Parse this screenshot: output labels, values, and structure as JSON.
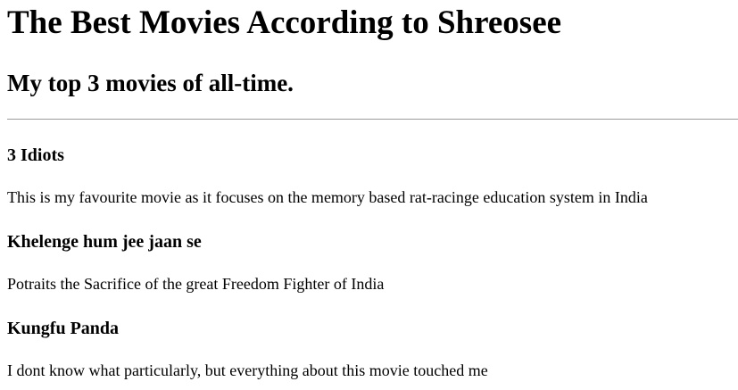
{
  "page": {
    "title": "The Best Movies According to Shreosee",
    "subtitle": "My top 3 movies of all-time."
  },
  "movies": [
    {
      "title": "3 Idiots",
      "description": "This is my favourite movie as it focuses on the memory based rat-racinge education system in India"
    },
    {
      "title": "Khelenge hum jee jaan se",
      "description": "Potraits the Sacrifice of the great Freedom Fighter of India"
    },
    {
      "title": "Kungfu Panda",
      "description": "I dont know what particularly, but everything about this movie touched me"
    }
  ]
}
